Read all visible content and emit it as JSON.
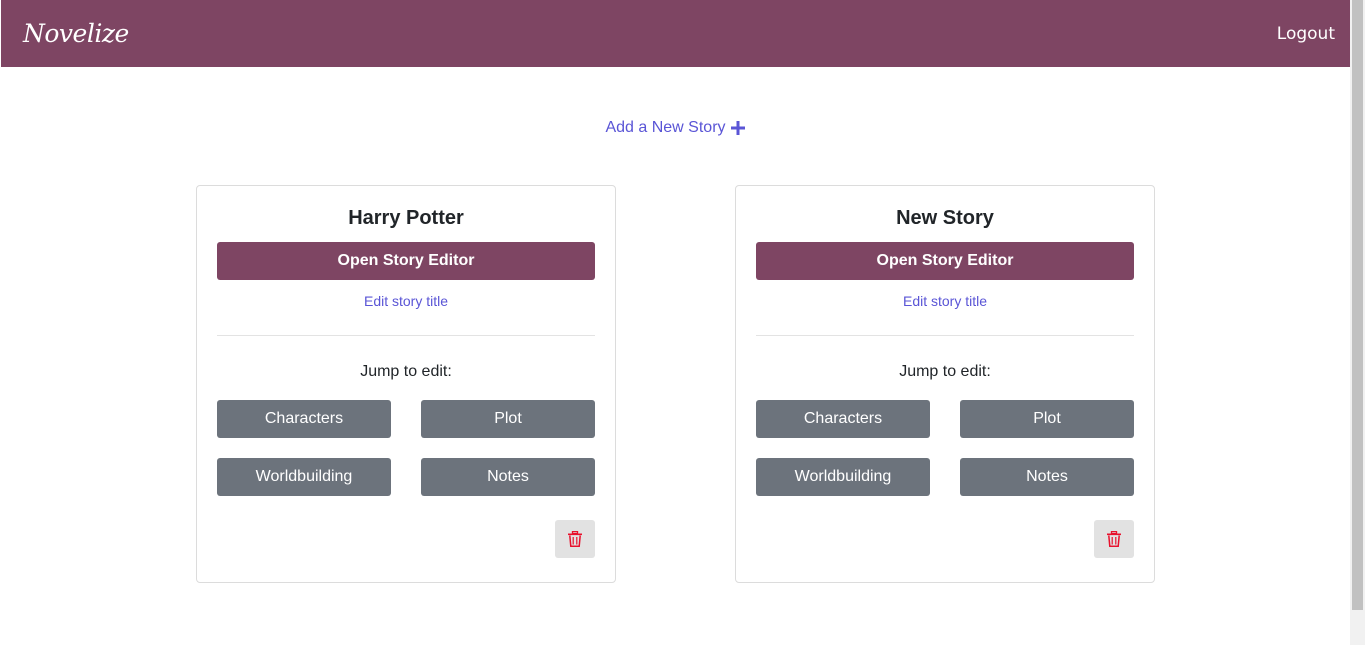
{
  "navbar": {
    "brand": "Novelize",
    "logout_label": "Logout",
    "color": "#7e4563"
  },
  "add_story": {
    "label": "Add a New Story",
    "icon": "plus-icon"
  },
  "stories": [
    {
      "title": "Harry Potter",
      "open_label": "Open Story Editor",
      "edit_title_label": "Edit story title",
      "jump_label": "Jump to edit:",
      "jump_buttons": [
        "Characters",
        "Plot",
        "Worldbuilding",
        "Notes"
      ],
      "delete_icon": "trash-icon"
    },
    {
      "title": "New Story",
      "open_label": "Open Story Editor",
      "edit_title_label": "Edit story title",
      "jump_label": "Jump to edit:",
      "jump_buttons": [
        "Characters",
        "Plot",
        "Worldbuilding",
        "Notes"
      ],
      "delete_icon": "trash-icon"
    }
  ],
  "colors": {
    "brand": "#7e4563",
    "link": "#5a55d6",
    "secondary_button": "#6c737c",
    "delete_icon": "#e8112d"
  }
}
